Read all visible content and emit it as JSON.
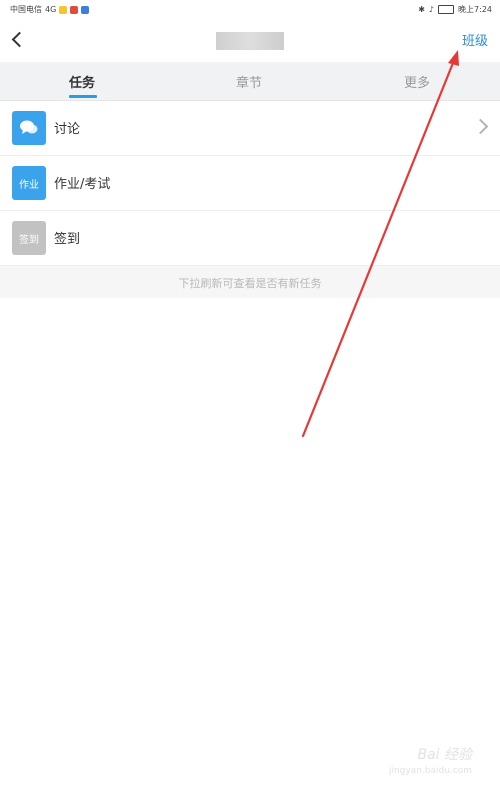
{
  "status_bar": {
    "carrier": "中国电信",
    "network": "4G",
    "time": "晚上7:24"
  },
  "header": {
    "right_link": "班级"
  },
  "tabs": [
    {
      "label": "任务",
      "active": true
    },
    {
      "label": "章节",
      "active": false
    },
    {
      "label": "更多",
      "active": false
    }
  ],
  "items": [
    {
      "label": "讨论",
      "icon": "discussion-bubble-icon",
      "icon_color": "#3aa3ec",
      "icon_text": ""
    },
    {
      "label": "作业/考试",
      "icon": "homework-icon",
      "icon_color": "#3aa3ec",
      "icon_text": "作业"
    },
    {
      "label": "签到",
      "icon": "checkin-icon",
      "icon_color": "#c2c2c2",
      "icon_text": "签到"
    }
  ],
  "hint": "下拉刷新可查看是否有新任务",
  "watermark": {
    "main": "Bai 经验",
    "sub": "jingyan.baidu.com"
  },
  "colors": {
    "accent": "#2a9be8",
    "arrow": "#e53935"
  }
}
